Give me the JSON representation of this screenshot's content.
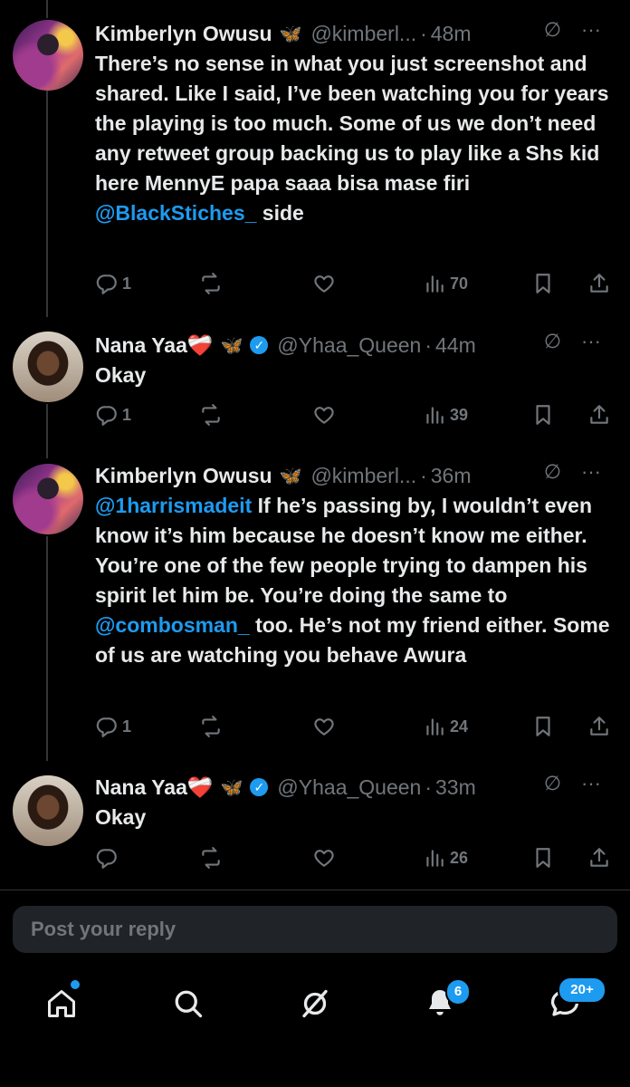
{
  "tweets": [
    {
      "name": "Kimberlyn Owusu",
      "badge": "🦋",
      "handle": "@kimberl...",
      "time": "48m",
      "segments": [
        {
          "t": "There’s no sense in what you just screenshot and shared. Like I said, I’ve been watching you for years the playing is too much. Some of us we don’t need any retweet group backing us to play like a Shs kid here MennyE papa saaa bisa mase firi "
        },
        {
          "m": "@BlackStiches_"
        },
        {
          "t": " side"
        }
      ],
      "replies": "1",
      "views": "70"
    },
    {
      "name": "Nana Yaa❤️‍🩹",
      "badge": "🦋",
      "handle": "@Yhaa_Queen",
      "time": "44m",
      "segments": [
        {
          "t": "Okay"
        }
      ],
      "replies": "1",
      "views": "39"
    },
    {
      "name": "Kimberlyn Owusu",
      "badge": "🦋",
      "handle": "@kimberl...",
      "time": "36m",
      "segments": [
        {
          "m": "@1harrismadeit"
        },
        {
          "t": " If he’s passing by, I wouldn’t even know it’s him because he doesn’t know me either. You’re one of the few people trying to dampen his spirit let him be. You’re doing the same to "
        },
        {
          "m": "@combosman_"
        },
        {
          "t": " too. He’s not my friend either. Some of us are watching you behave Awura"
        }
      ],
      "replies": "1",
      "views": "24"
    },
    {
      "name": "Nana Yaa❤️‍🩹",
      "badge": "🦋",
      "handle": "@Yhaa_Queen",
      "time": "33m",
      "segments": [
        {
          "t": "Okay"
        }
      ],
      "replies": "",
      "views": "26"
    }
  ],
  "reply_placeholder": "Post your reply",
  "tabbar": {
    "notifications_count": "6",
    "messages_count": "20+"
  },
  "colors": {
    "accent": "#1d9bf0",
    "muted": "#71767b",
    "text": "#e7e9ea"
  }
}
